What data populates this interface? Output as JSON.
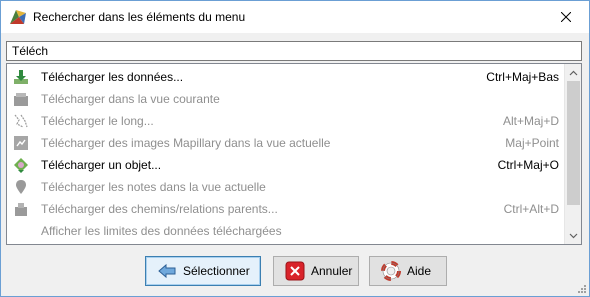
{
  "window": {
    "title": "Rechercher dans les éléments du menu",
    "app_icon": "josm-icon",
    "close_icon": "close-icon"
  },
  "search": {
    "value": "Téléch"
  },
  "items": [
    {
      "label": "Télécharger les données...",
      "shortcut": "Ctrl+Maj+Bas",
      "icon": "download-icon",
      "enabled": true
    },
    {
      "label": "Télécharger dans la vue courante",
      "shortcut": "",
      "icon": "download-view-icon",
      "enabled": false
    },
    {
      "label": "Télécharger le long...",
      "shortcut": "Alt+Maj+D",
      "icon": "download-along-icon",
      "enabled": false
    },
    {
      "label": "Télécharger des images Mapillary dans la vue actuelle",
      "shortcut": "Maj+Point",
      "icon": "mapillary-icon",
      "enabled": false
    },
    {
      "label": "Télécharger un objet...",
      "shortcut": "Ctrl+Maj+O",
      "icon": "download-object-icon",
      "enabled": true
    },
    {
      "label": "Télécharger les notes dans la vue actuelle",
      "shortcut": "",
      "icon": "notes-icon",
      "enabled": false
    },
    {
      "label": "Télécharger des chemins/relations parents...",
      "shortcut": "Ctrl+Alt+D",
      "icon": "download-parents-icon",
      "enabled": false
    },
    {
      "label": "Afficher les limites des données téléchargées",
      "shortcut": "",
      "icon": "",
      "enabled": false
    }
  ],
  "buttons": {
    "select": {
      "label": "Sélectionner",
      "icon": "select-arrow-icon"
    },
    "cancel": {
      "label": "Annuler",
      "icon": "cancel-icon"
    },
    "help": {
      "label": "Aide",
      "icon": "help-lifebuoy-icon"
    }
  },
  "colors": {
    "enabled_text": "#000000",
    "disabled_text": "#8f8f8f",
    "default_button_border": "#3c7fb1",
    "cancel_red": "#d9232a"
  }
}
